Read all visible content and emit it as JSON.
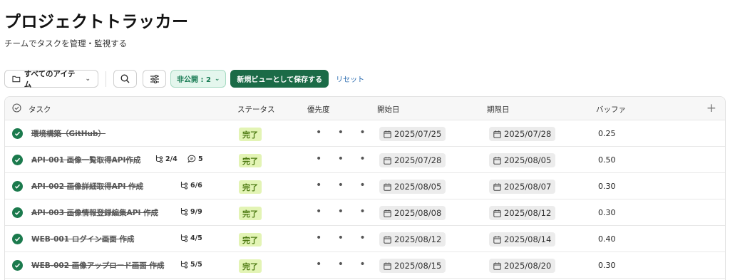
{
  "header": {
    "title": "プロジェクトトラッカー",
    "subtitle": "チームでタスクを管理・監視する"
  },
  "toolbar": {
    "view_label": "すべてのアイテム",
    "filter_label": "非公開 : 2",
    "save_label": "新規ビューとして保存する",
    "reset_label": "リセット"
  },
  "table": {
    "columns": {
      "task": "タスク",
      "status": "ステータス",
      "priority": "優先度",
      "start": "開始日",
      "due": "期限日",
      "buffer": "バッファ"
    },
    "rows": [
      {
        "name": "環境構築（GitHub）",
        "subtasks": "",
        "comments": "",
        "status": "完了",
        "priority": "• • •",
        "start": "2025/07/25",
        "due": "2025/07/28",
        "buffer": "0.25"
      },
      {
        "name": "API-001 画像一覧取得API作成",
        "subtasks": "2/4",
        "comments": "5",
        "status": "完了",
        "priority": "• • •",
        "start": "2025/07/28",
        "due": "2025/08/05",
        "buffer": "0.50"
      },
      {
        "name": "API-002 画像詳細取得API 作成",
        "subtasks": "6/6",
        "comments": "",
        "status": "完了",
        "priority": "• • •",
        "start": "2025/08/05",
        "due": "2025/08/07",
        "buffer": "0.30"
      },
      {
        "name": "API-003 画像情報登録編集API 作成",
        "subtasks": "9/9",
        "comments": "",
        "status": "完了",
        "priority": "• • •",
        "start": "2025/08/08",
        "due": "2025/08/12",
        "buffer": "0.30"
      },
      {
        "name": "WEB-001 ログイン画面 作成",
        "subtasks": "4/5",
        "comments": "",
        "status": "完了",
        "priority": "• • •",
        "start": "2025/08/12",
        "due": "2025/08/14",
        "buffer": "0.40"
      },
      {
        "name": "WEB-002 画像アップロード画面 作成",
        "subtasks": "5/5",
        "comments": "",
        "status": "完了",
        "priority": "• • •",
        "start": "2025/08/15",
        "due": "2025/08/20",
        "buffer": "0.30"
      }
    ]
  },
  "icons": {
    "folder": "folder-icon",
    "search": "search-icon",
    "settings": "sliders-icon",
    "check": "check-circle-icon",
    "subtask": "subtask-icon",
    "comment": "comment-icon",
    "calendar": "calendar-icon",
    "add": "plus-icon"
  },
  "colors": {
    "accent": "#1b6b47",
    "status_done_bg": "#e3f4b5",
    "status_done_text": "#4d7a12",
    "link": "#2b6cb0"
  }
}
